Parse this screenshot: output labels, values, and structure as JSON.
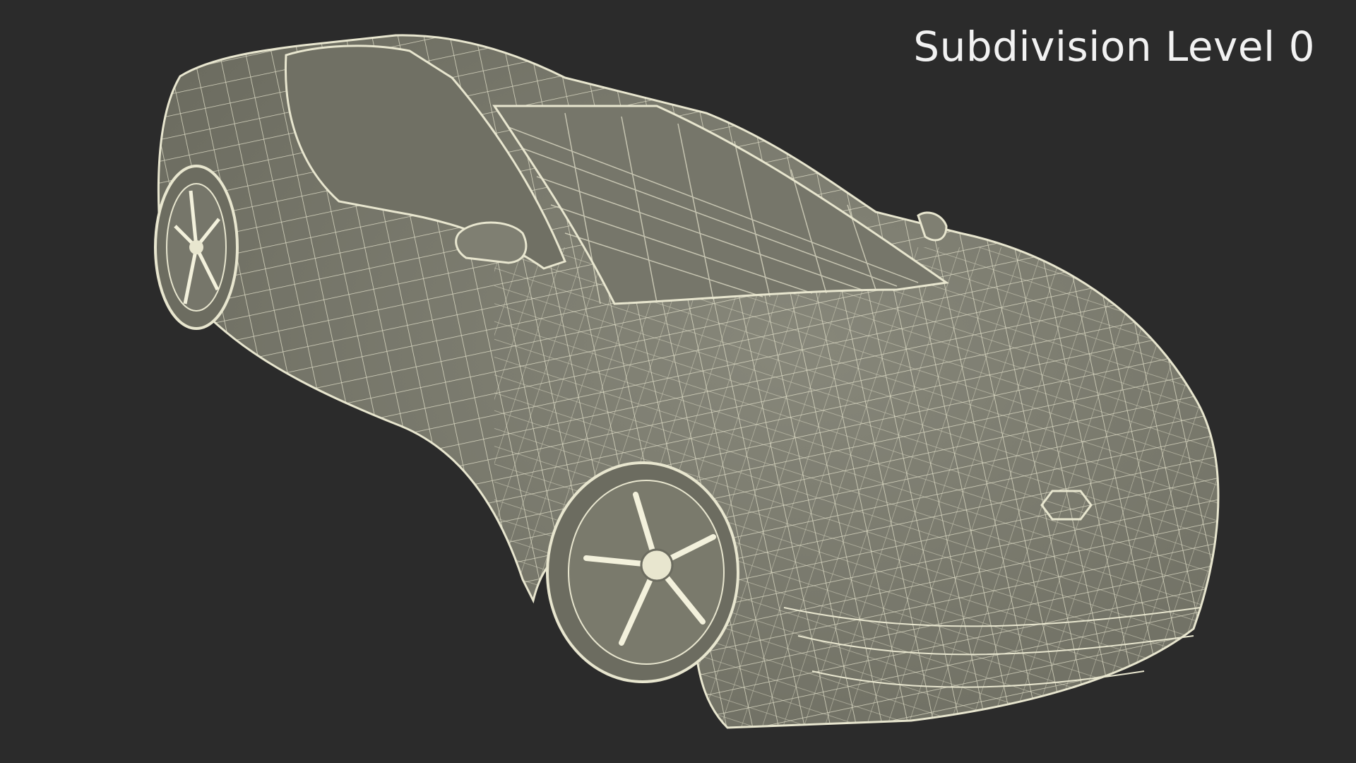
{
  "label": "Subdivision Level 0",
  "colors": {
    "background": "#2b2b2b",
    "surface": "#7a7a6c",
    "wire": "#e8e6cf",
    "text": "#f2f2f2"
  }
}
